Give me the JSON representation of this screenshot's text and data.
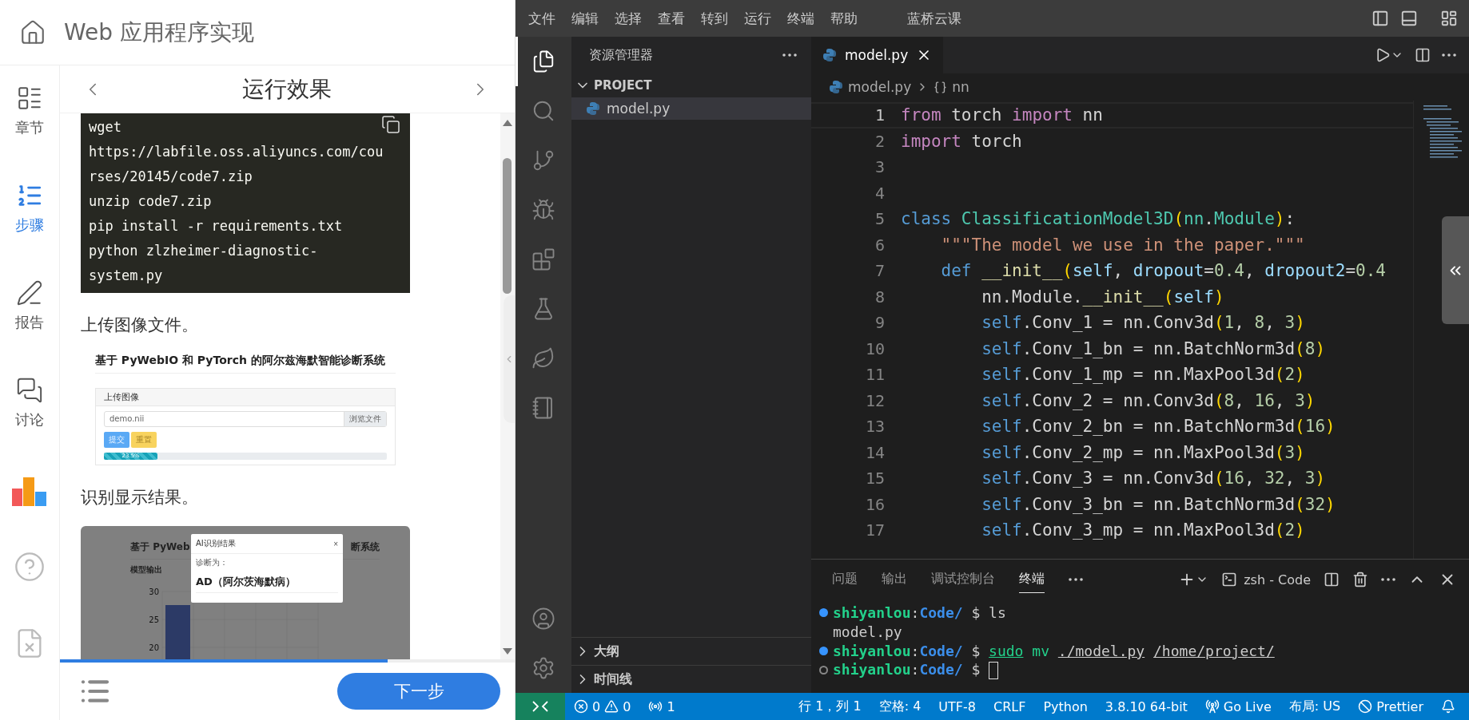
{
  "course": {
    "title": "Web 应用程序实现"
  },
  "nav": [
    {
      "kind": "chapters",
      "label": "章节",
      "selected": false
    },
    {
      "kind": "steps",
      "label": "步骤",
      "selected": true
    },
    {
      "kind": "report",
      "label": "报告",
      "selected": false
    },
    {
      "kind": "discuss",
      "label": "讨论",
      "selected": false
    },
    {
      "kind": "ranking",
      "selected": false
    },
    {
      "kind": "help",
      "selected": false
    },
    {
      "kind": "feedback",
      "selected": false
    }
  ],
  "step": {
    "title": "运行效果"
  },
  "content": {
    "code_block": [
      "wget",
      "https://labfile.oss.aliyuncs.com/cou",
      "rses/20145/code7.zip",
      "unzip code7.zip",
      "pip install -r requirements.txt",
      "python zlzheimer-diagnostic-",
      "system.py"
    ],
    "paragraph_1": "上传图像文件。",
    "screenshot_1": {
      "title": "基于 PyWebIO 和 PyTorch 的阿尔兹海默智能诊断系统",
      "panel_title": "上传图像",
      "file_value": "demo.nii",
      "browse_button": "浏览文件",
      "buttons": [
        {
          "kind": "primary",
          "label": "提交"
        },
        {
          "kind": "warning",
          "label": "重置"
        }
      ],
      "progress": {
        "level": 0.19,
        "label": "23.5%"
      }
    },
    "paragraph_2": "识别显示结果。",
    "screenshot_2": {
      "background_title": [
        "基于 PyWeb",
        "断系统"
      ],
      "chart": {
        "title": "模型输出",
        "tick_labels": [
          "30",
          "25",
          "20"
        ]
      },
      "dialog": {
        "title": "AI识别结果",
        "close": "×",
        "label": "诊断为：",
        "result": "AD（阿尔茨海默病）"
      }
    }
  },
  "reading_progress": {
    "level": 0.72
  },
  "next_button": "下一步",
  "vscode": {
    "menu": [
      "文件",
      "编辑",
      "选择",
      "查看",
      "转到",
      "运行",
      "终端",
      "帮助"
    ],
    "title": "蓝桥云课",
    "activity_top": [
      {
        "kind": "explorer",
        "selected": true
      },
      {
        "kind": "search",
        "selected": false
      },
      {
        "kind": "scm",
        "selected": false
      },
      {
        "kind": "debug",
        "selected": false
      },
      {
        "kind": "extensions",
        "selected": false
      },
      {
        "kind": "testing",
        "selected": false
      },
      {
        "kind": "leaf",
        "selected": false
      },
      {
        "kind": "notebook",
        "selected": false
      }
    ],
    "activity_bottom": [
      {
        "kind": "account",
        "selected": false
      },
      {
        "kind": "settings",
        "selected": false
      }
    ],
    "explorer": {
      "title": "资源管理器",
      "folder": {
        "name": "PROJECT",
        "expanded": true,
        "files": [
          {
            "name": "model.py",
            "selected": true
          }
        ]
      },
      "sections": [
        {
          "name": "大纲",
          "expanded": false
        },
        {
          "name": "时间线",
          "expanded": false
        }
      ]
    },
    "tabs": [
      {
        "name": "model.py",
        "selected": true
      }
    ],
    "breadcrumb": {
      "file": "model.py",
      "symbol": "nn"
    },
    "code": [
      {
        "number": "1",
        "current": true,
        "tokens": [
          {
            "kind": "kw",
            "text": "from"
          },
          {
            "kind": "plain",
            "text": " torch "
          },
          {
            "kind": "kw",
            "text": "import"
          },
          {
            "kind": "plain",
            "text": " nn"
          }
        ]
      },
      {
        "number": "2",
        "current": false,
        "tokens": [
          {
            "kind": "kw",
            "text": "import"
          },
          {
            "kind": "plain",
            "text": " torch"
          }
        ]
      },
      {
        "number": "3",
        "current": false
      },
      {
        "number": "4",
        "current": false
      },
      {
        "number": "5",
        "current": false,
        "tokens": [
          {
            "kind": "storage",
            "text": "class"
          },
          {
            "kind": "cls",
            "text": " ClassificationModel3D"
          },
          {
            "kind": "paren",
            "text": "("
          },
          {
            "kind": "cls",
            "text": "nn"
          },
          {
            "kind": "plain",
            "text": "."
          },
          {
            "kind": "cls",
            "text": "Module"
          },
          {
            "kind": "paren",
            "text": ")"
          },
          {
            "kind": "plain",
            "text": ":"
          }
        ]
      },
      {
        "number": "6",
        "current": false,
        "tokens": [
          {
            "kind": "str",
            "text": "    \"\"\"The model we use in the paper.\"\"\""
          }
        ]
      },
      {
        "number": "7",
        "current": false,
        "tokens": [
          {
            "kind": "storage",
            "text": "    def"
          },
          {
            "kind": "fn",
            "text": " __init__"
          },
          {
            "kind": "paren",
            "text": "("
          },
          {
            "kind": "param",
            "text": "self"
          },
          {
            "kind": "plain",
            "text": ", "
          },
          {
            "kind": "param",
            "text": "dropout"
          },
          {
            "kind": "plain",
            "text": "="
          },
          {
            "kind": "num",
            "text": "0.4"
          },
          {
            "kind": "plain",
            "text": ", "
          },
          {
            "kind": "param",
            "text": "dropout2"
          },
          {
            "kind": "plain",
            "text": "="
          },
          {
            "kind": "num",
            "text": "0.4"
          }
        ]
      },
      {
        "number": "8",
        "current": false,
        "tokens": [
          {
            "kind": "plain",
            "text": "        nn.Module."
          },
          {
            "kind": "fn",
            "text": "__init__"
          },
          {
            "kind": "paren",
            "text": "("
          },
          {
            "kind": "param",
            "text": "self"
          },
          {
            "kind": "paren",
            "text": ")"
          }
        ]
      },
      {
        "number": "9",
        "current": false,
        "tokens": [
          {
            "kind": "storage",
            "text": "        self"
          },
          {
            "kind": "plain",
            "text": ".Conv_1 = nn.Conv3d"
          },
          {
            "kind": "paren",
            "text": "("
          },
          {
            "kind": "num",
            "text": "1"
          },
          {
            "kind": "plain",
            "text": ", "
          },
          {
            "kind": "num",
            "text": "8"
          },
          {
            "kind": "plain",
            "text": ", "
          },
          {
            "kind": "num",
            "text": "3"
          },
          {
            "kind": "paren",
            "text": ")"
          }
        ]
      },
      {
        "number": "10",
        "current": false,
        "tokens": [
          {
            "kind": "storage",
            "text": "        self"
          },
          {
            "kind": "plain",
            "text": ".Conv_1_bn = nn.BatchNorm3d"
          },
          {
            "kind": "paren",
            "text": "("
          },
          {
            "kind": "num",
            "text": "8"
          },
          {
            "kind": "paren",
            "text": ")"
          }
        ]
      },
      {
        "number": "11",
        "current": false,
        "tokens": [
          {
            "kind": "storage",
            "text": "        self"
          },
          {
            "kind": "plain",
            "text": ".Conv_1_mp = nn.MaxPool3d"
          },
          {
            "kind": "paren",
            "text": "("
          },
          {
            "kind": "num",
            "text": "2"
          },
          {
            "kind": "paren",
            "text": ")"
          }
        ]
      },
      {
        "number": "12",
        "current": false,
        "tokens": [
          {
            "kind": "storage",
            "text": "        self"
          },
          {
            "kind": "plain",
            "text": ".Conv_2 = nn.Conv3d"
          },
          {
            "kind": "paren",
            "text": "("
          },
          {
            "kind": "num",
            "text": "8"
          },
          {
            "kind": "plain",
            "text": ", "
          },
          {
            "kind": "num",
            "text": "16"
          },
          {
            "kind": "plain",
            "text": ", "
          },
          {
            "kind": "num",
            "text": "3"
          },
          {
            "kind": "paren",
            "text": ")"
          }
        ]
      },
      {
        "number": "13",
        "current": false,
        "tokens": [
          {
            "kind": "storage",
            "text": "        self"
          },
          {
            "kind": "plain",
            "text": ".Conv_2_bn = nn.BatchNorm3d"
          },
          {
            "kind": "paren",
            "text": "("
          },
          {
            "kind": "num",
            "text": "16"
          },
          {
            "kind": "paren",
            "text": ")"
          }
        ]
      },
      {
        "number": "14",
        "current": false,
        "tokens": [
          {
            "kind": "storage",
            "text": "        self"
          },
          {
            "kind": "plain",
            "text": ".Conv_2_mp = nn.MaxPool3d"
          },
          {
            "kind": "paren",
            "text": "("
          },
          {
            "kind": "num",
            "text": "3"
          },
          {
            "kind": "paren",
            "text": ")"
          }
        ]
      },
      {
        "number": "15",
        "current": false,
        "tokens": [
          {
            "kind": "storage",
            "text": "        self"
          },
          {
            "kind": "plain",
            "text": ".Conv_3 = nn.Conv3d"
          },
          {
            "kind": "paren",
            "text": "("
          },
          {
            "kind": "num",
            "text": "16"
          },
          {
            "kind": "plain",
            "text": ", "
          },
          {
            "kind": "num",
            "text": "32"
          },
          {
            "kind": "plain",
            "text": ", "
          },
          {
            "kind": "num",
            "text": "3"
          },
          {
            "kind": "paren",
            "text": ")"
          }
        ]
      },
      {
        "number": "16",
        "current": false,
        "tokens": [
          {
            "kind": "storage",
            "text": "        self"
          },
          {
            "kind": "plain",
            "text": ".Conv_3_bn = nn.BatchNorm3d"
          },
          {
            "kind": "paren",
            "text": "("
          },
          {
            "kind": "num",
            "text": "32"
          },
          {
            "kind": "paren",
            "text": ")"
          }
        ]
      },
      {
        "number": "17",
        "current": false,
        "tokens": [
          {
            "kind": "storage",
            "text": "        self"
          },
          {
            "kind": "plain",
            "text": ".Conv_3_mp = nn.MaxPool3d"
          },
          {
            "kind": "paren",
            "text": "("
          },
          {
            "kind": "num",
            "text": "2"
          },
          {
            "kind": "paren",
            "text": ")"
          }
        ]
      }
    ],
    "panel": {
      "tabs": [
        {
          "label": "问题",
          "selected": false
        },
        {
          "label": "输出",
          "selected": false
        },
        {
          "label": "调试控制台",
          "selected": false
        },
        {
          "label": "终端",
          "selected": true
        }
      ],
      "terminal_name": "zsh - Code"
    },
    "terminal": [
      {
        "kind": "prompt",
        "finished": true,
        "tokens": [
          {
            "kind": "user",
            "text": "shiyanlou"
          },
          {
            "kind": "plain",
            "text": ":"
          },
          {
            "kind": "dir",
            "text": "Code/"
          },
          {
            "kind": "plain",
            "text": " $ ls"
          }
        ]
      },
      {
        "kind": "output",
        "tokens": [
          {
            "kind": "plain",
            "text": "model.py"
          }
        ]
      },
      {
        "kind": "prompt",
        "finished": true,
        "tokens": [
          {
            "kind": "user",
            "text": "shiyanlou"
          },
          {
            "kind": "plain",
            "text": ":"
          },
          {
            "kind": "dir",
            "text": "Code/"
          },
          {
            "kind": "plain",
            "text": " $ "
          },
          {
            "kind": "cmd_u",
            "text": "sudo"
          },
          {
            "kind": "cmd",
            "text": " mv "
          },
          {
            "kind": "arg_u",
            "text": "./model.py"
          },
          {
            "kind": "spaced_arg_u",
            "text": "/home/project/"
          }
        ]
      },
      {
        "kind": "prompt",
        "finished": false,
        "cursor": true,
        "tokens": [
          {
            "kind": "user",
            "text": "shiyanlou"
          },
          {
            "kind": "plain",
            "text": ":"
          },
          {
            "kind": "dir",
            "text": "Code/"
          },
          {
            "kind": "plain",
            "text": " $"
          }
        ]
      }
    ],
    "status_bar": {
      "left": [
        {
          "kind": "remote"
        },
        {
          "kind": "problems",
          "errors": "0",
          "warnings": "0"
        },
        {
          "kind": "ports",
          "text": "1"
        }
      ],
      "right": [
        {
          "kind": "text",
          "text": "行 1，列 1"
        },
        {
          "kind": "text",
          "text": "空格: 4"
        },
        {
          "kind": "text",
          "text": "UTF-8"
        },
        {
          "kind": "text",
          "text": "CRLF"
        },
        {
          "kind": "text",
          "text": "Python"
        },
        {
          "kind": "text",
          "text": "3.8.10 64-bit"
        },
        {
          "kind": "live",
          "text": "Go Live"
        },
        {
          "kind": "text",
          "text": "布局: US"
        },
        {
          "kind": "prettier",
          "text": "Prettier"
        },
        {
          "kind": "bell"
        }
      ]
    }
  }
}
